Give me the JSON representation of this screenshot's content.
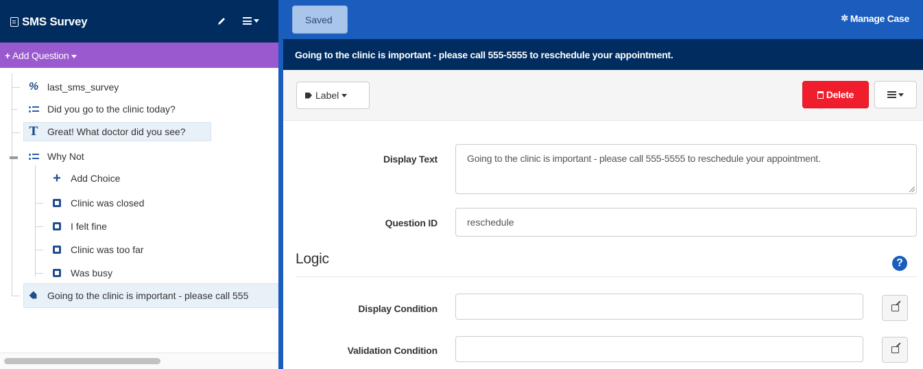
{
  "sidebar": {
    "title": "SMS Survey",
    "add_question_label": "Add Question",
    "tree": [
      {
        "label": "last_sms_survey",
        "icon": "variable-icon"
      },
      {
        "label": "Did you go to the clinic today?",
        "icon": "multiple-choice-icon"
      },
      {
        "label": "Great! What doctor did you see?",
        "icon": "text-question-icon"
      },
      {
        "label": "Why Not",
        "icon": "multiple-choice-icon"
      },
      {
        "label": "Add Choice",
        "icon": "plus-icon"
      },
      {
        "label": "Clinic was closed",
        "icon": "checkbox-icon"
      },
      {
        "label": "I felt fine",
        "icon": "checkbox-icon"
      },
      {
        "label": "Clinic was too far",
        "icon": "checkbox-icon"
      },
      {
        "label": "Was busy",
        "icon": "checkbox-icon"
      },
      {
        "label": "Going to the clinic is important - please call 555",
        "icon": "tag-icon"
      }
    ]
  },
  "topbar": {
    "saved_label": "Saved",
    "manage_case_label": "Manage Case"
  },
  "message_bar": {
    "text": "Going to the clinic is important - please call 555-5555 to reschedule your appointment."
  },
  "toolbar": {
    "label_button": "Label",
    "delete_button": "Delete"
  },
  "form": {
    "display_text_label": "Display Text",
    "display_text_value": "Going to the clinic is important - please call 555-5555 to reschedule your appointment.",
    "question_id_label": "Question ID",
    "question_id_value": "reschedule"
  },
  "logic": {
    "title": "Logic",
    "help_glyph": "?",
    "display_condition_label": "Display Condition",
    "display_condition_value": "",
    "validation_condition_label": "Validation Condition",
    "validation_condition_value": ""
  },
  "colors": {
    "navy": "#002c5f",
    "blue": "#1a5dbd",
    "purple": "#9b59d0",
    "delete_red": "#f01e2c"
  }
}
